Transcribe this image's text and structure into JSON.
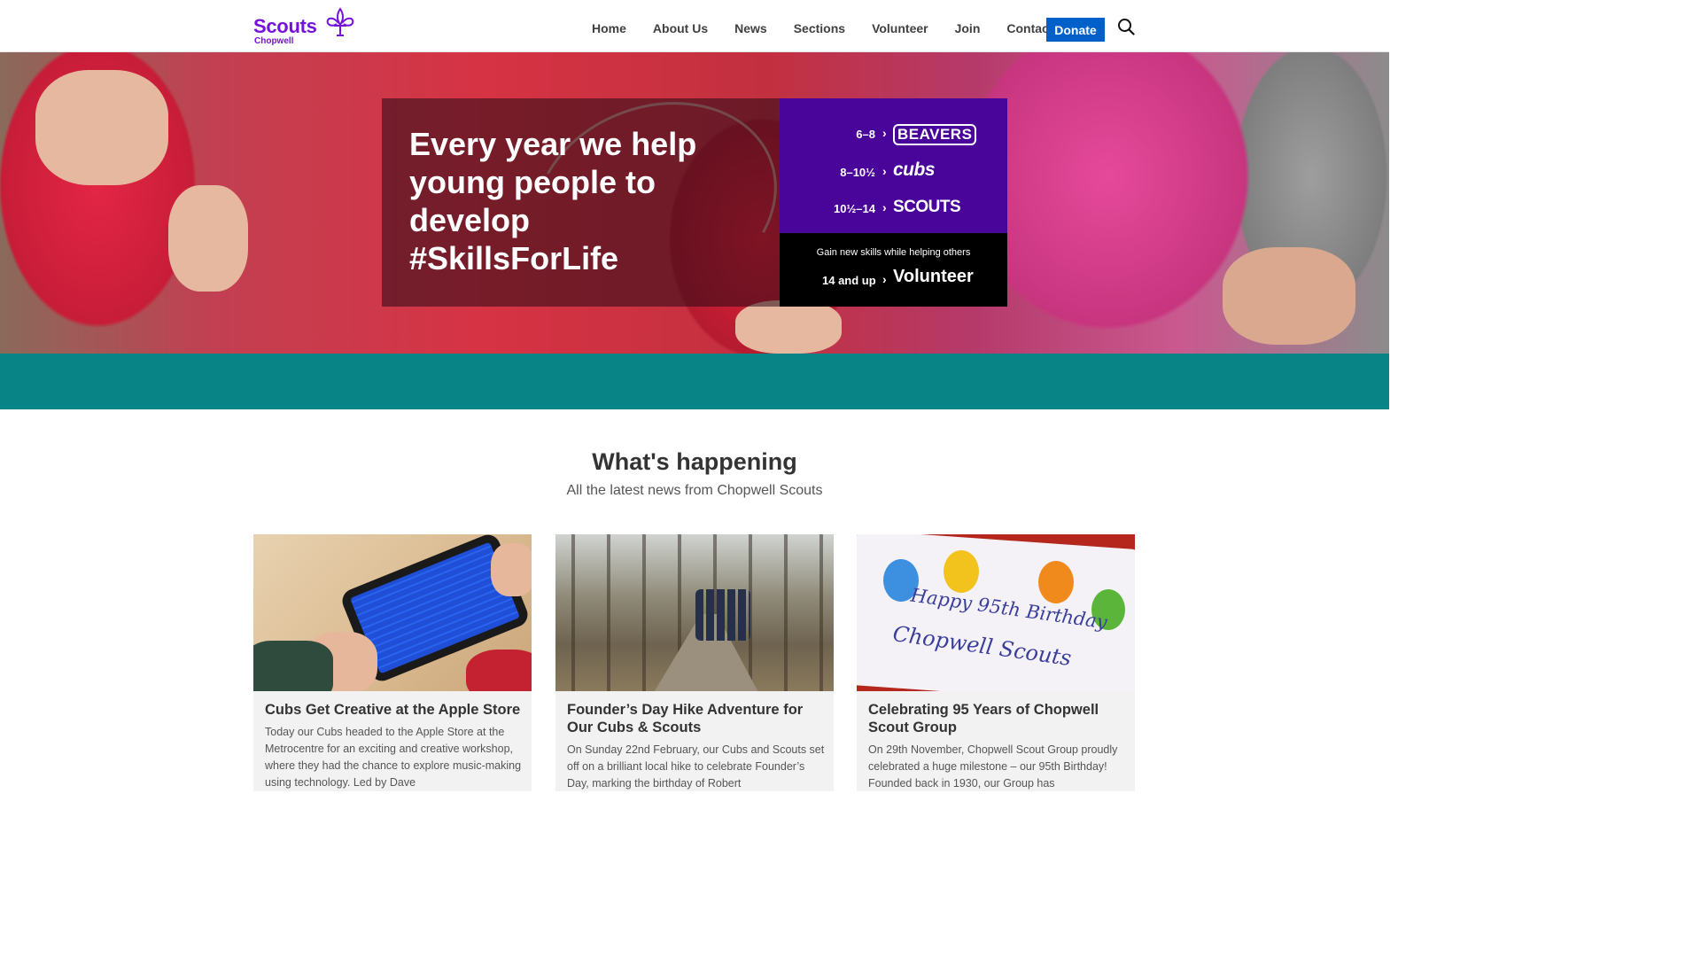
{
  "header": {
    "logo_text": "Scouts",
    "logo_sub": "Chopwell",
    "nav": [
      "Home",
      "About Us",
      "News",
      "Sections",
      "Volunteer",
      "Join",
      "Contact"
    ],
    "donate_label": "Donate",
    "icons": {
      "logo": "fleur-de-lis-icon",
      "search": "search-icon"
    },
    "brand_color": "#7413dc",
    "donate_color": "#0060c9"
  },
  "hero": {
    "heading": "Every year we help young people to develop #SkillsForLife",
    "sections": [
      {
        "age": "6–8",
        "name": "BEAVERS"
      },
      {
        "age": "8–10½",
        "name": "cubs"
      },
      {
        "age": "10½–14",
        "name": "SCOUTS"
      }
    ],
    "volunteer": {
      "tagline": "Gain new skills while helping others",
      "age": "14 and up",
      "name": "Volunteer"
    },
    "sections_bg": "#490499",
    "band_color": "#088486"
  },
  "news": {
    "title": "What's happening",
    "subtitle": "All the latest news from Chopwell Scouts",
    "cards": [
      {
        "title": "Cubs Get Creative at the Apple Store",
        "body": "Today our Cubs headed to the Apple Store at the Metrocentre for an exciting and creative workshop, where they had the chance to explore music-making using technology. Led by Dave"
      },
      {
        "title": "Founder’s Day Hike Adventure for Our Cubs & Scouts",
        "body": "On Sunday 22nd February, our Cubs and Scouts set off on a brilliant local hike to celebrate Founder’s Day, marking the birthday of Robert"
      },
      {
        "title": "Celebrating 95 Years of Chopwell Scout Group",
        "body": "On 29th November, Chopwell Scout Group proudly celebrated a huge milestone – our 95th Birthday! Founded back in 1930, our Group has"
      }
    ],
    "cake_text": [
      "Happy 95th Birthday",
      "Chopwell Scouts"
    ]
  }
}
